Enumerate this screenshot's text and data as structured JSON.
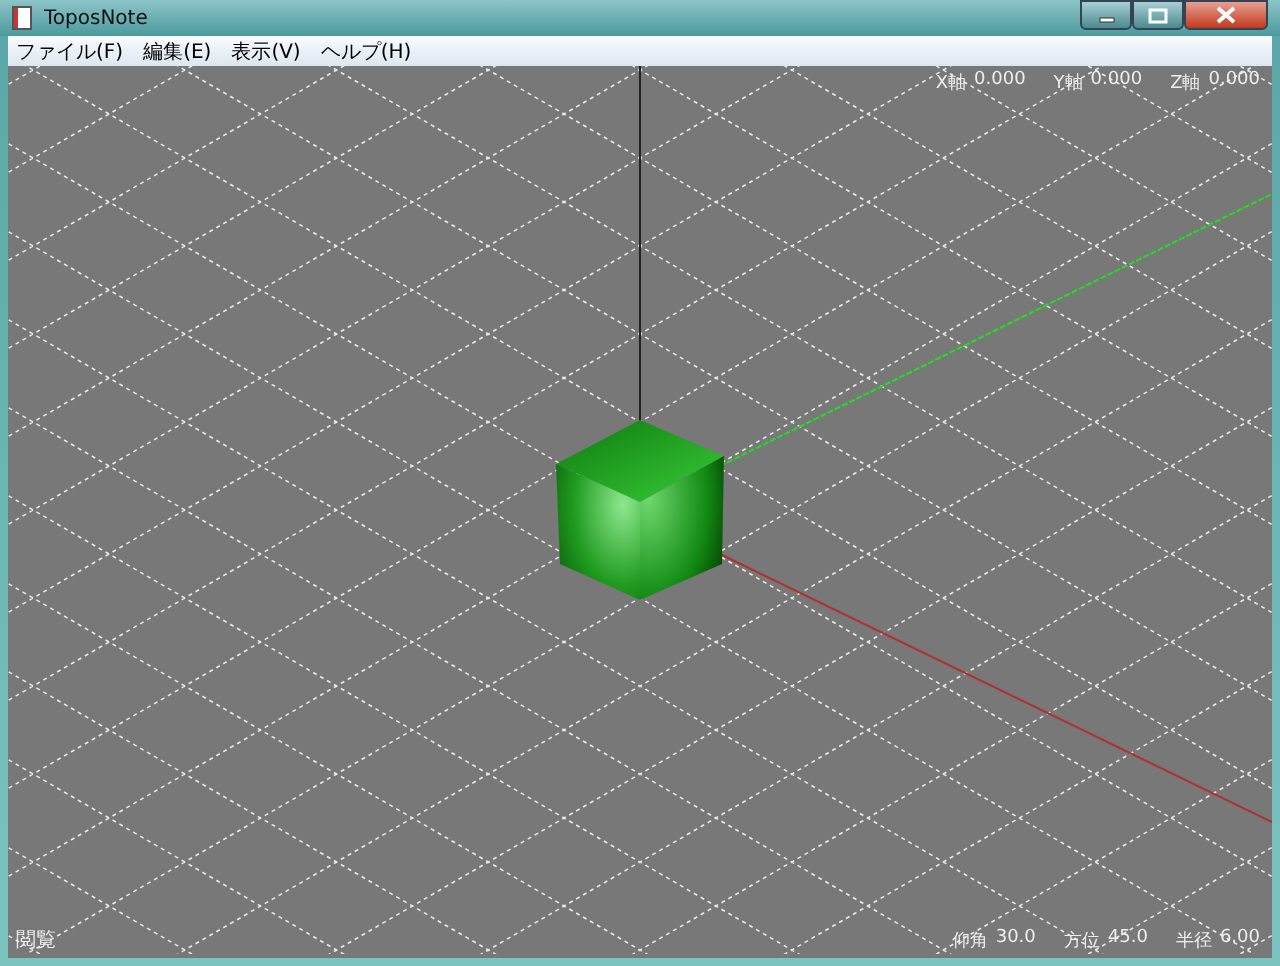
{
  "window": {
    "title": "ToposNote"
  },
  "menu": [
    {
      "label": "ファイル(F)"
    },
    {
      "label": "編集(E)"
    },
    {
      "label": "表示(V)"
    },
    {
      "label": "ヘルプ(H)"
    }
  ],
  "viewport": {
    "axes": [
      {
        "label": "X軸",
        "value": "0.000"
      },
      {
        "label": "Y軸",
        "value": "0.000"
      },
      {
        "label": "Z軸",
        "value": "0.000"
      }
    ],
    "mode": "閲覧",
    "camera": [
      {
        "label": "仰角",
        "value": "30.0"
      },
      {
        "label": "方位",
        "value": "45.0"
      },
      {
        "label": "半径",
        "value": "6.00"
      }
    ]
  }
}
